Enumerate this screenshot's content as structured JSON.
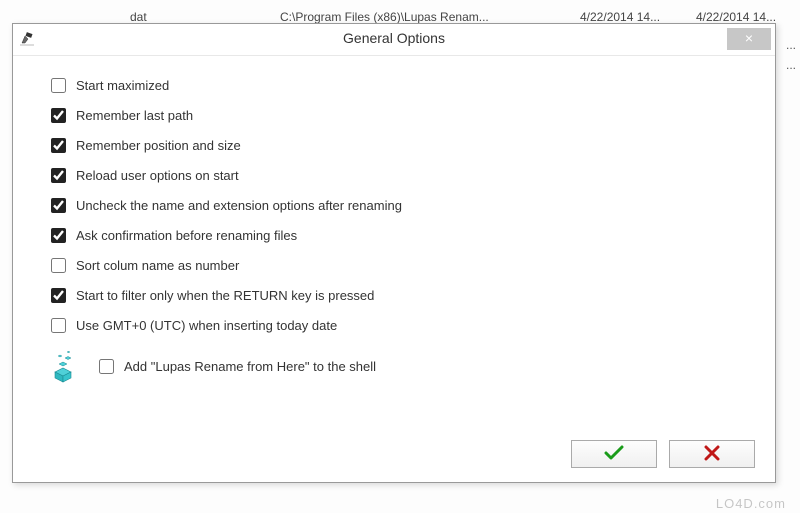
{
  "background": {
    "ext": "dat",
    "path": "C:\\Program Files (x86)\\Lupas Renam...",
    "date1": "4/22/2014 14...",
    "date2": "4/22/2014 14..."
  },
  "dialog": {
    "title": "General Options",
    "close_label": "×",
    "options": [
      {
        "label": "Start maximized",
        "checked": false
      },
      {
        "label": "Remember last path",
        "checked": true
      },
      {
        "label": "Remember position and size",
        "checked": true
      },
      {
        "label": "Reload user options on start",
        "checked": true
      },
      {
        "label": "Uncheck the name and extension options after renaming",
        "checked": true
      },
      {
        "label": "Ask confirmation before renaming files",
        "checked": true
      },
      {
        "label": "Sort colum name as number",
        "checked": false
      },
      {
        "label": "Start to filter only when the RETURN key is pressed",
        "checked": true
      },
      {
        "label": "Use GMT+0 (UTC) when inserting today date",
        "checked": false
      }
    ],
    "shell_option": {
      "label": "Add \"Lupas Rename from Here\" to the shell",
      "checked": false
    }
  },
  "watermark": "LO4D.com"
}
